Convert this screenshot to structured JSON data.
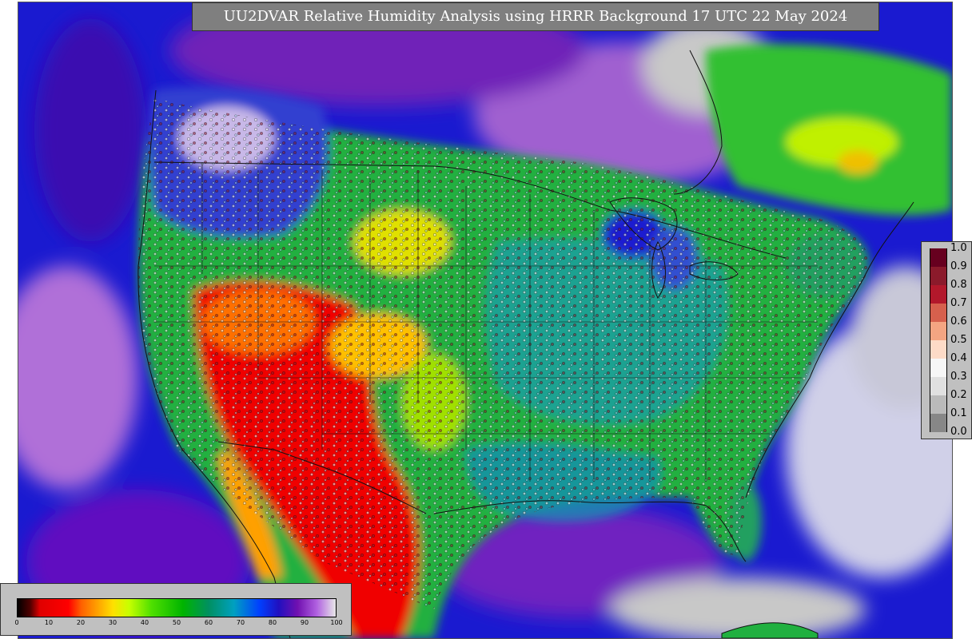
{
  "title": "UU2DVAR Relative Humidity Analysis using HRRR Background 17 UTC 22 May 2024",
  "colorbar": {
    "ticks": [
      "0",
      "10",
      "20",
      "30",
      "40",
      "50",
      "60",
      "70",
      "80",
      "90",
      "100"
    ]
  },
  "side_legend": {
    "labels": [
      "1.0",
      "0.9",
      "0.8",
      "0.7",
      "0.6",
      "0.5",
      "0.4",
      "0.3",
      "0.2",
      "0.1",
      "0.0"
    ],
    "colors": [
      "#67001f",
      "#8b1a2b",
      "#b2182b",
      "#d6604d",
      "#f4a582",
      "#fddbc7",
      "#f7f7f7",
      "#e0e0e0",
      "#bababa",
      "#878787",
      "#4d7a9a"
    ]
  },
  "colors": {
    "frame_bg": "#c8c8c8",
    "panel_bg": "#c0c0c0",
    "title_bg": "#7f7f7f"
  }
}
